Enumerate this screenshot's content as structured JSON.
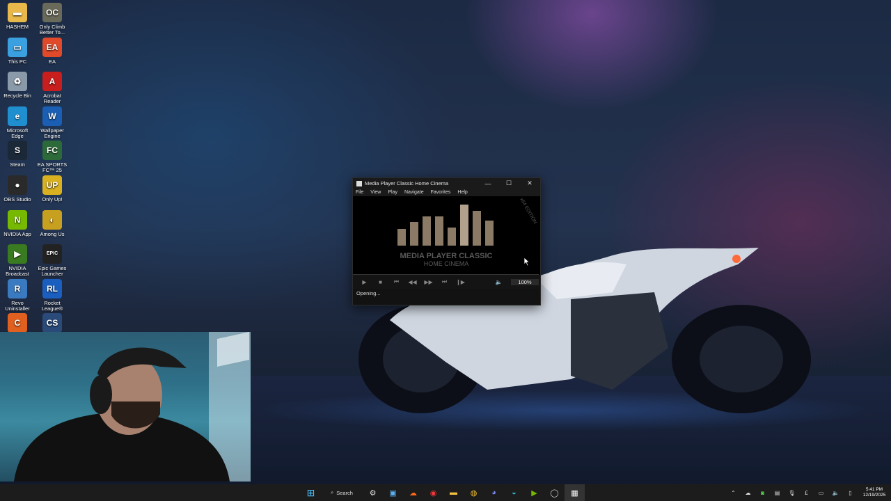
{
  "desktop": {
    "icons": [
      {
        "label": "HASHEM",
        "icon": "folder-icon",
        "color": "#e8b84a",
        "glyph": "▬"
      },
      {
        "label": "Only Climb Better To...",
        "icon": "game-icon",
        "color": "#6a6a5a",
        "glyph": "OC"
      },
      {
        "label": "This PC",
        "icon": "monitor-icon",
        "color": "#3aa0e0",
        "glyph": "▭"
      },
      {
        "label": "EA",
        "icon": "ea-icon",
        "color": "#e04a2a",
        "glyph": "EA"
      },
      {
        "label": "Recycle Bin",
        "icon": "recycle-bin-icon",
        "color": "#8a9aa8",
        "glyph": "♻"
      },
      {
        "label": "Acrobat Reader",
        "icon": "acrobat-icon",
        "color": "#c81e1e",
        "glyph": "A"
      },
      {
        "label": "Microsoft Edge",
        "icon": "edge-icon",
        "color": "#1f8fd0",
        "glyph": "e"
      },
      {
        "label": "Wallpaper Engine",
        "icon": "wallpaper-engine-icon",
        "color": "#1a5fb4",
        "glyph": "W"
      },
      {
        "label": "Steam",
        "icon": "steam-icon",
        "color": "#1b2838",
        "glyph": "S"
      },
      {
        "label": "EA SPORTS FC™ 25",
        "icon": "fc25-icon",
        "color": "#2d6a3a",
        "glyph": "FC"
      },
      {
        "label": "OBS Studio",
        "icon": "obs-icon",
        "color": "#2a2a2a",
        "glyph": "●"
      },
      {
        "label": "Only Up!",
        "icon": "only-up-icon",
        "color": "#d8b020",
        "glyph": "UP"
      },
      {
        "label": "NVIDIA App",
        "icon": "nvidia-icon",
        "color": "#76b900",
        "glyph": "N"
      },
      {
        "label": "Among Us",
        "icon": "among-us-icon",
        "color": "#c8a020",
        "glyph": "◐"
      },
      {
        "label": "NVIDIA Broadcast",
        "icon": "nvidia-broadcast-icon",
        "color": "#3a7a20",
        "glyph": "▶"
      },
      {
        "label": "Epic Games Launcher",
        "icon": "epic-games-icon",
        "color": "#222222",
        "glyph": "EPIC"
      },
      {
        "label": "Revo Uninstaller",
        "icon": "revo-icon",
        "color": "#3a7ac0",
        "glyph": "R"
      },
      {
        "label": "Rocket League®",
        "icon": "rocket-league-icon",
        "color": "#1a5fc0",
        "glyph": "RL"
      },
      {
        "label": "",
        "icon": "app-icon",
        "color": "#e06020",
        "glyph": "C"
      },
      {
        "label": "",
        "icon": "counter-strike-icon",
        "color": "#2a4a7a",
        "glyph": "CS"
      }
    ]
  },
  "mpc": {
    "title": "Media Player Classic Home Cinema",
    "menu": [
      "File",
      "View",
      "Play",
      "Navigate",
      "Favorites",
      "Help"
    ],
    "logo_line1": "MEDIA PLAYER CLASSIC",
    "logo_line2": "HOME CINEMA",
    "edition": "x64 EDITION",
    "zoom": "100%",
    "status": "Opening..."
  },
  "taskbar": {
    "search_label": "Search",
    "apps": [
      "start-icon",
      "settings-icon",
      "photos-icon",
      "soundcloud-icon",
      "vivaldi-icon",
      "file-explorer-icon",
      "chrome-icon",
      "discord-icon",
      "edge-icon",
      "nvidia-broadcast-icon",
      "opera-icon",
      "mpc-icon"
    ],
    "tray": [
      "chevron-up-icon",
      "onedrive-icon",
      "xbox-icon",
      "security-icon",
      "mic-icon",
      "language-icon",
      "display-icon",
      "volume-icon",
      "battery-icon"
    ],
    "lang": "£",
    "time": "5:41 PM",
    "date": "12/19/2025"
  }
}
